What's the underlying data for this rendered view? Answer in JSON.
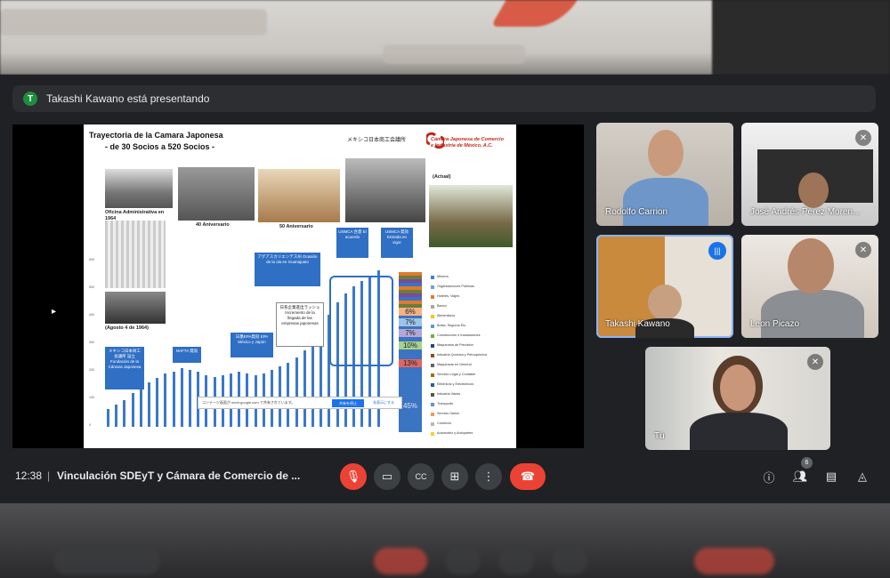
{
  "presenter_banner": {
    "avatar_letter": "T",
    "text": "Takashi Kawano está presentando"
  },
  "slide": {
    "title_line1": "Trayectoria de la Camara Japonesa",
    "title_line2": "- de 30 Socios a 520 Socios -",
    "logo_japanese": "メキシコ日本商工会議所",
    "logo_line1": "Cámara Japonesa de Comercio",
    "logo_line2": "e Industria de México, A.C.",
    "captions": {
      "oficina": "Oficina Administrativa en 1964",
      "aniv40": "40 Aniversario",
      "aniv50": "50 Aniversario",
      "actual": "(Actual)",
      "agosto": "(Agosto 4 de 1964)"
    },
    "callouts": {
      "fundacion": "メキシコ日本商工会議所 設立 Fundación de la Cámara Japonesa",
      "nafta": "NAFTA 発効",
      "tlc": "日墨EPA発効 EPA México y Japón",
      "auto": "アグアスカリエンテス州 Ocasión de la ola en Guanajuato",
      "japan": "日系企業進出ラッシュ Incremento de la llegada de las empresas japonesas",
      "usmca1": "USMCA 合意 El acuerdo",
      "usmca2": "USMCA 発効 Entrada en vigor"
    },
    "percentages": [
      "6%",
      "7%",
      "7%",
      "10%",
      "13%",
      "45%"
    ],
    "legend": [
      "Minería",
      "Organizaciones Públicas",
      "Hoteles, Viajes",
      "Banco",
      "Alimenticios",
      "Bolsa, Seguros Etc.",
      "Construcción e Instalaciones",
      "Maquinaria de Precisión",
      "Industria Química y Petroquímica",
      "Maquinaria en General",
      "Servicio Legal y Contable",
      "Eléctricos y Electrónicos",
      "Industria Varias",
      "Transporte",
      "Servicio Varios",
      "Comercio",
      "Automotriz y Autopartes"
    ],
    "notification": {
      "text": "コンテーツ画面が meet.google.com で共有されています。",
      "button": "共有を停止",
      "link": "非表示にする"
    },
    "y_ticks": [
      "600",
      "500",
      "400",
      "300",
      "200",
      "100",
      "0"
    ]
  },
  "participants": [
    {
      "name": "Rodolfo Carrion"
    },
    {
      "name": "José Andrés Pérez Moren..."
    },
    {
      "name": "Takashi Kawano"
    },
    {
      "name": "Leon Picazo"
    },
    {
      "name": "Tú"
    }
  ],
  "toolbar": {
    "time": "12:38",
    "separator": "|",
    "meeting_title": "Vinculación SDEyT y Cámara de Comercio de ...",
    "participant_count": "6"
  }
}
